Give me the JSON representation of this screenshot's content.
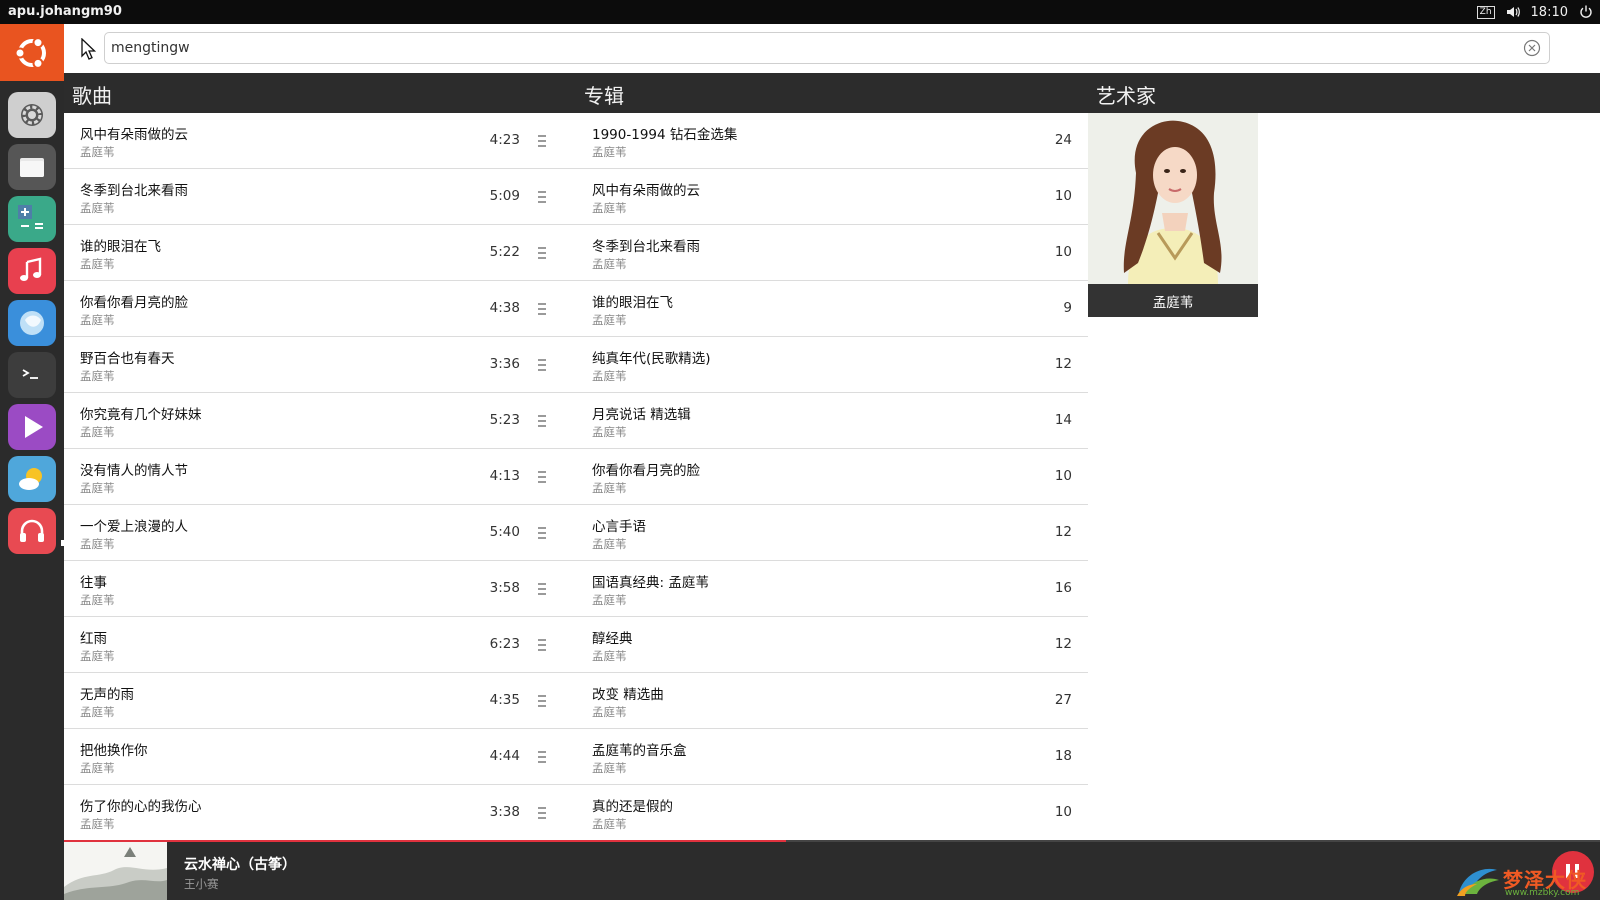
{
  "panel": {
    "title": "apu.johangm90",
    "keyboard_layout": "Zh",
    "clock": "18:10"
  },
  "launcher": {
    "items": [
      {
        "name": "ubuntu-home",
        "icon": "ubuntu-logo-icon",
        "color": "#e95420"
      },
      {
        "name": "system-settings",
        "icon": "gear-icon",
        "color": "#8c8c8c"
      },
      {
        "name": "files",
        "icon": "folder-icon",
        "color": "#6d6d6d"
      },
      {
        "name": "calculator",
        "icon": "calculator-icon",
        "color": "#3aa989"
      },
      {
        "name": "music",
        "icon": "music-note-icon",
        "color": "#e8404f"
      },
      {
        "name": "browser",
        "icon": "browser-icon",
        "color": "#3a8fdb"
      },
      {
        "name": "terminal",
        "icon": "terminal-icon",
        "color": "#3d3d3d"
      },
      {
        "name": "media-player",
        "icon": "play-icon",
        "color": "#9b4bc4"
      },
      {
        "name": "weather",
        "icon": "weather-icon",
        "color": "#4fa7db"
      },
      {
        "name": "music-app",
        "icon": "headphones-icon",
        "color": "#e84a52"
      }
    ]
  },
  "search": {
    "query": "mengtingw"
  },
  "sections": {
    "songs": "歌曲",
    "albums": "专辑",
    "artists": "艺术家"
  },
  "songs": [
    {
      "title": "风中有朵雨做的云",
      "artist": "孟庭苇",
      "duration": "4:23"
    },
    {
      "title": "冬季到台北来看雨",
      "artist": "孟庭苇",
      "duration": "5:09"
    },
    {
      "title": "谁的眼泪在飞",
      "artist": "孟庭苇",
      "duration": "5:22"
    },
    {
      "title": "你看你看月亮的脸",
      "artist": "孟庭苇",
      "duration": "4:38"
    },
    {
      "title": "野百合也有春天",
      "artist": "孟庭苇",
      "duration": "3:36"
    },
    {
      "title": "你究竟有几个好妹妹",
      "artist": "孟庭苇",
      "duration": "5:23"
    },
    {
      "title": "没有情人的情人节",
      "artist": "孟庭苇",
      "duration": "4:13"
    },
    {
      "title": "一个爱上浪漫的人",
      "artist": "孟庭苇",
      "duration": "5:40"
    },
    {
      "title": "往事",
      "artist": "孟庭苇",
      "duration": "3:58"
    },
    {
      "title": "红雨",
      "artist": "孟庭苇",
      "duration": "6:23"
    },
    {
      "title": "无声的雨",
      "artist": "孟庭苇",
      "duration": "4:35"
    },
    {
      "title": "把他换作你",
      "artist": "孟庭苇",
      "duration": "4:44"
    },
    {
      "title": "伤了你的心的我伤心",
      "artist": "孟庭苇",
      "duration": "3:38"
    }
  ],
  "albums": [
    {
      "title": "1990-1994 钻石金选集",
      "artist": "孟庭苇",
      "count": "24"
    },
    {
      "title": "风中有朵雨做的云",
      "artist": "孟庭苇",
      "count": "10"
    },
    {
      "title": "冬季到台北来看雨",
      "artist": "孟庭苇",
      "count": "10"
    },
    {
      "title": "谁的眼泪在飞",
      "artist": "孟庭苇",
      "count": "9"
    },
    {
      "title": "纯真年代(民歌精选)",
      "artist": "孟庭苇",
      "count": "12"
    },
    {
      "title": "月亮说话 精选辑",
      "artist": "孟庭苇",
      "count": "14"
    },
    {
      "title": "你看你看月亮的脸",
      "artist": "孟庭苇",
      "count": "10"
    },
    {
      "title": "心言手语",
      "artist": "孟庭苇",
      "count": "12"
    },
    {
      "title": "国语真经典: 孟庭苇",
      "artist": "孟庭苇",
      "count": "16"
    },
    {
      "title": "醇经典",
      "artist": "孟庭苇",
      "count": "12"
    },
    {
      "title": "改变 精选曲",
      "artist": "孟庭苇",
      "count": "27"
    },
    {
      "title": "孟庭苇的音乐盒",
      "artist": "孟庭苇",
      "count": "18"
    },
    {
      "title": "真的还是假的",
      "artist": "孟庭苇",
      "count": "10"
    }
  ],
  "artists": [
    {
      "name": "孟庭苇"
    }
  ],
  "now_playing": {
    "title": "云水禅心（古筝）",
    "artist": "王小赛",
    "progress": 0.47
  },
  "watermark": {
    "text": "梦泽大侠",
    "url": "www.mzbky.com"
  },
  "colors": {
    "accent": "#e0323e",
    "launcher_home": "#e95420"
  }
}
